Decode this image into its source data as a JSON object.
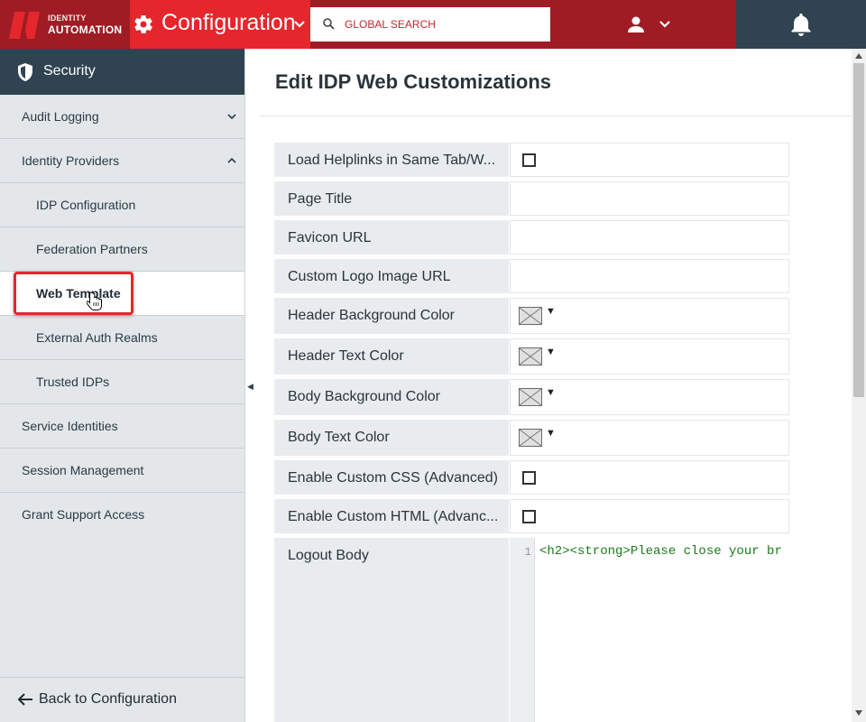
{
  "brand": {
    "line1": "IDENTITY",
    "line2": "AUTOMATION"
  },
  "header": {
    "section_title": "Configuration",
    "search_placeholder": "GLOBAL SEARCH"
  },
  "sidebar": {
    "section": "Security",
    "items": [
      {
        "label": "Audit Logging",
        "level": "top",
        "chevron": "down"
      },
      {
        "label": "Identity Providers",
        "level": "top",
        "chevron": "up"
      },
      {
        "label": "IDP Configuration",
        "level": "sub"
      },
      {
        "label": "Federation Partners",
        "level": "sub"
      },
      {
        "label": "Web Template",
        "level": "sub",
        "active": true
      },
      {
        "label": "External Auth Realms",
        "level": "sub"
      },
      {
        "label": "Trusted IDPs",
        "level": "sub"
      },
      {
        "label": "Service Identities",
        "level": "top"
      },
      {
        "label": "Session Management",
        "level": "top"
      },
      {
        "label": "Grant Support Access",
        "level": "top"
      }
    ],
    "back_label": "Back to Configuration"
  },
  "main": {
    "title": "Edit IDP Web Customizations",
    "fields": [
      {
        "label": "Load Helplinks in Same Tab/W...",
        "type": "checkbox",
        "checked": false
      },
      {
        "label": "Page Title",
        "type": "text",
        "value": ""
      },
      {
        "label": "Favicon URL",
        "type": "text",
        "value": ""
      },
      {
        "label": "Custom Logo Image URL",
        "type": "text",
        "value": ""
      },
      {
        "label": "Header Background Color",
        "type": "color",
        "value": "none"
      },
      {
        "label": "Header Text Color",
        "type": "color",
        "value": "none"
      },
      {
        "label": "Body Background Color",
        "type": "color",
        "value": "none"
      },
      {
        "label": "Body Text Color",
        "type": "color",
        "value": "none"
      },
      {
        "label": "Enable Custom CSS (Advanced)",
        "type": "checkbox",
        "checked": false
      },
      {
        "label": "Enable Custom HTML (Advanc...",
        "type": "checkbox",
        "checked": false
      },
      {
        "label": "Logout Body",
        "type": "code",
        "line_number": "1",
        "code": "<h2><strong>Please close your br"
      }
    ]
  },
  "colors": {
    "topbar": "#a01c24",
    "accent_red": "#e5262c",
    "dark_slate": "#2f4450",
    "sidebar_bg": "#e3e7ea"
  },
  "icons": [
    "gear-icon",
    "chevron-down-icon",
    "search-icon",
    "user-icon",
    "bell-icon",
    "shield-icon",
    "chevron-up-icon",
    "arrow-left-icon",
    "pointer-cursor-icon"
  ]
}
